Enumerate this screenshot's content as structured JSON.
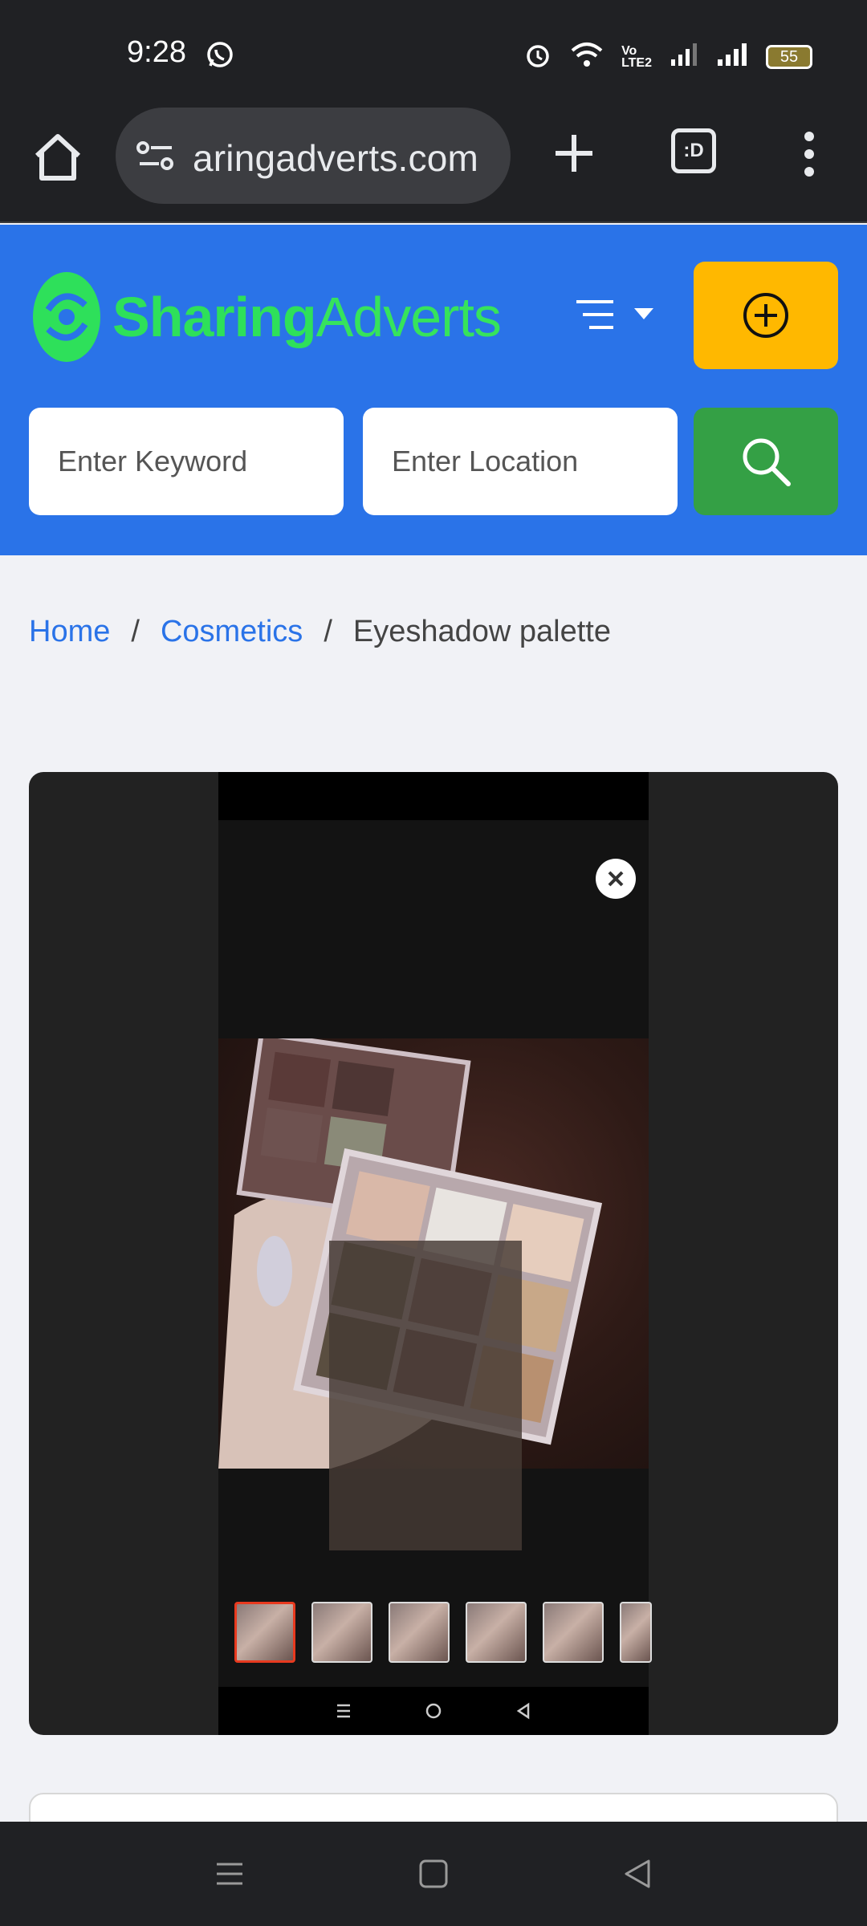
{
  "status_bar": {
    "time": "9:28",
    "battery": "55",
    "icons": [
      "whatsapp-icon",
      "alarm-icon",
      "wifi-icon",
      "volte-icon",
      "signal-icon",
      "signal-icon",
      "battery-icon"
    ]
  },
  "browser": {
    "url": "aringadverts.com",
    "tabs_label": ":D"
  },
  "header": {
    "logo_part1": "Sharing",
    "logo_part2": "Adverts",
    "keyword_placeholder": "Enter Keyword",
    "location_placeholder": "Enter Location",
    "colors": {
      "header_bg": "#2a73e8",
      "post_button": "#ffb800",
      "search_button": "#34a045",
      "logo": "#2ee05a"
    }
  },
  "breadcrumb": {
    "items": [
      "Home",
      "Cosmetics"
    ],
    "separator": "/",
    "current": "Eyeshadow palette"
  },
  "gallery": {
    "thumbnail_count": 6,
    "active_thumbnail": 1
  }
}
